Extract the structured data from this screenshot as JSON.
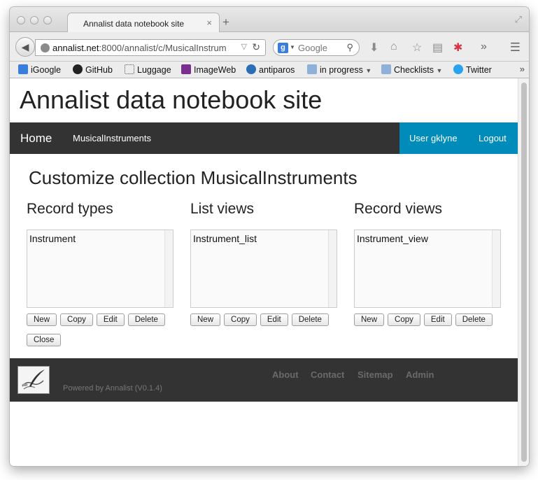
{
  "browser": {
    "tab_title": "Annalist data notebook site",
    "tab_close": "×",
    "new_tab": "+",
    "url_host": "annalist.net",
    "url_rest": ":8000/annalist/c/MusicalInstrum",
    "search_placeholder": "Google",
    "search_engine_letter": "g"
  },
  "bookmarks": [
    {
      "label": "iGoogle",
      "icon": "igoogle-icon",
      "color": "#3b7ddd"
    },
    {
      "label": "GitHub",
      "icon": "github-icon",
      "color": "#222222"
    },
    {
      "label": "Luggage",
      "icon": "dotted-box-icon",
      "color": "#ffffff"
    },
    {
      "label": "ImageWeb",
      "icon": "imageweb-icon",
      "color": "#7a2e8f"
    },
    {
      "label": "antiparos",
      "icon": "antiparos-icon",
      "color": "#2a6fb5"
    },
    {
      "label": "in progress",
      "icon": "folder-icon",
      "color": "#8fb0d8"
    },
    {
      "label": "Checklists",
      "icon": "folder-icon",
      "color": "#8fb0d8"
    },
    {
      "label": "Twitter",
      "icon": "twitter-icon",
      "color": "#2aa3ef"
    }
  ],
  "site": {
    "title": "Annalist data notebook site",
    "nav": {
      "home": "Home",
      "collection": "MusicalInstruments",
      "user": "User gklyne",
      "logout": "Logout"
    },
    "heading": "Customize collection MusicalInstruments",
    "columns": [
      {
        "title": "Record types",
        "item": "Instrument"
      },
      {
        "title": "List views",
        "item": "Instrument_list"
      },
      {
        "title": "Record views",
        "item": "Instrument_view"
      }
    ],
    "buttons": {
      "new": "New",
      "copy": "Copy",
      "edit": "Edit",
      "delete": "Delete",
      "close": "Close"
    },
    "footer": {
      "powered": "Powered by Annalist (V0.1.4)",
      "links": [
        "About",
        "Contact",
        "Sitemap",
        "Admin"
      ]
    }
  },
  "colors": {
    "nav_bg": "#333333",
    "user_bg": "#008cba"
  }
}
